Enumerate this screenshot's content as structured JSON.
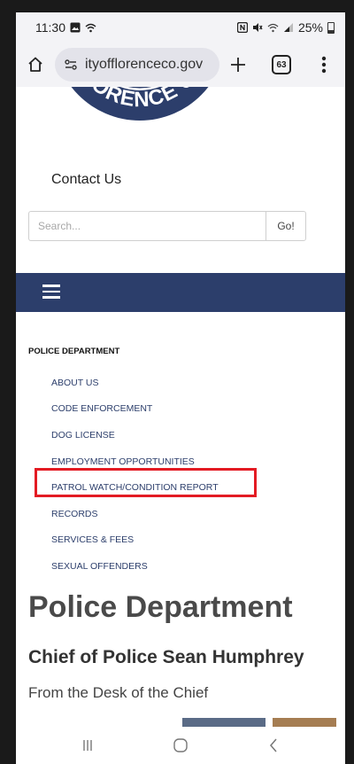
{
  "status_bar": {
    "time": "11:30",
    "battery": "25%"
  },
  "browser": {
    "url": "ityofflorenceco.gov",
    "tab_count": "63"
  },
  "logo": {
    "text": "FLORENCE CO"
  },
  "page": {
    "contact_link": "Contact Us",
    "search": {
      "placeholder": "Search...",
      "button": "Go!"
    },
    "section_title": "POLICE DEPARTMENT",
    "submenu": [
      "ABOUT US",
      "CODE ENFORCEMENT",
      "DOG LICENSE",
      "EMPLOYMENT OPPORTUNITIES",
      "PATROL WATCH/CONDITION REPORT",
      "RECORDS",
      "SERVICES & FEES",
      "SEXUAL OFFENDERS"
    ],
    "heading": "Police Department",
    "subheading": "Chief of Police Sean Humphrey",
    "desk_line": "From the Desk of the Chief"
  },
  "colors": {
    "nav_band": "#2c3e6b",
    "highlight": "#e31b23",
    "link": "#2c3e6b"
  },
  "icons": [
    "home-icon",
    "site-info-icon",
    "plus-icon",
    "tabs-icon",
    "overflow-menu-icon",
    "hamburger-menu-icon",
    "recents-icon",
    "home-nav-icon",
    "back-icon"
  ]
}
